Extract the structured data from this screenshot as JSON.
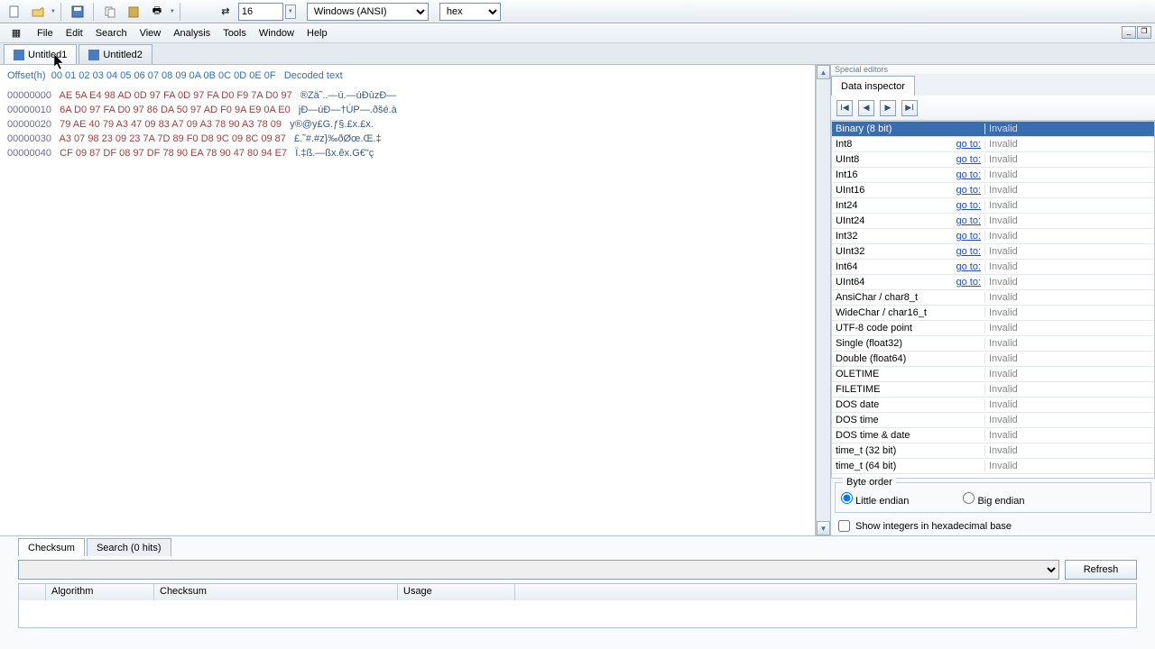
{
  "toolbar": {
    "lines": "16",
    "encoding": "Windows (ANSI)",
    "mode": "hex"
  },
  "menu": [
    "File",
    "Edit",
    "Search",
    "View",
    "Analysis",
    "Tools",
    "Window",
    "Help"
  ],
  "tabs": [
    "Untitled1",
    "Untitled2"
  ],
  "hex": {
    "header_offset": "Offset(h)",
    "header_cols": "00 01 02 03 04 05 06 07 08 09 0A 0B 0C 0D 0E 0F",
    "header_txt": "Decoded text",
    "rows": [
      {
        "o": "00000000",
        "b": "AE 5A E4 98 AD 0D 97 FA 0D 97 FA D0 F9 7A D0 97",
        "t": "®Zä˜..—ú.—úÐùzÐ—"
      },
      {
        "o": "00000010",
        "b": "6A D0 97 FA D0 97 86 DA 50 97 AD F0 9A E9 0A E0",
        "t": "jÐ—úÐ—†ÚP—.ðšé.à"
      },
      {
        "o": "00000020",
        "b": "79 AE 40 79 A3 47 09 83 A7 09 A3 78 90 A3 78 09",
        "t": "y®@y£G.ƒ§.£x.£x."
      },
      {
        "o": "00000030",
        "b": "A3 07 98 23 09 23 7A 7D 89 F0 D8 9C 09 8C 09 87",
        "t": "£.˜#.#z}‰ðØœ.Œ.‡"
      },
      {
        "o": "00000040",
        "b": "CF 09 87 DF 08 97 DF 78 90 EA 78 90 47 80 94 E7",
        "t": "Ï.‡ß.—ßx.êx.G€\"ç"
      }
    ]
  },
  "inspector": {
    "special_label": "Special editors",
    "tab": "Data inspector",
    "types": [
      {
        "n": "Binary (8 bit)",
        "g": false,
        "v": "Invalid",
        "sel": true
      },
      {
        "n": "Int8",
        "g": true,
        "v": "Invalid"
      },
      {
        "n": "UInt8",
        "g": true,
        "v": "Invalid"
      },
      {
        "n": "Int16",
        "g": true,
        "v": "Invalid"
      },
      {
        "n": "UInt16",
        "g": true,
        "v": "Invalid"
      },
      {
        "n": "Int24",
        "g": true,
        "v": "Invalid"
      },
      {
        "n": "UInt24",
        "g": true,
        "v": "Invalid"
      },
      {
        "n": "Int32",
        "g": true,
        "v": "Invalid"
      },
      {
        "n": "UInt32",
        "g": true,
        "v": "Invalid"
      },
      {
        "n": "Int64",
        "g": true,
        "v": "Invalid"
      },
      {
        "n": "UInt64",
        "g": true,
        "v": "Invalid"
      },
      {
        "n": "AnsiChar / char8_t",
        "g": false,
        "v": "Invalid"
      },
      {
        "n": "WideChar / char16_t",
        "g": false,
        "v": "Invalid"
      },
      {
        "n": "UTF-8 code point",
        "g": false,
        "v": "Invalid"
      },
      {
        "n": "Single (float32)",
        "g": false,
        "v": "Invalid"
      },
      {
        "n": "Double (float64)",
        "g": false,
        "v": "Invalid"
      },
      {
        "n": "OLETIME",
        "g": false,
        "v": "Invalid"
      },
      {
        "n": "FILETIME",
        "g": false,
        "v": "Invalid"
      },
      {
        "n": "DOS date",
        "g": false,
        "v": "Invalid"
      },
      {
        "n": "DOS time",
        "g": false,
        "v": "Invalid"
      },
      {
        "n": "DOS time & date",
        "g": false,
        "v": "Invalid"
      },
      {
        "n": "time_t (32 bit)",
        "g": false,
        "v": "Invalid"
      },
      {
        "n": "time_t (64 bit)",
        "g": false,
        "v": "Invalid"
      }
    ],
    "goto_label": "go to:",
    "byteorder_label": "Byte order",
    "little": "Little endian",
    "big": "Big endian",
    "showhex": "Show integers in hexadecimal base"
  },
  "bottom": {
    "tabs": [
      "Checksum",
      "Search (0 hits)"
    ],
    "refresh": "Refresh",
    "cols": [
      "",
      "Algorithm",
      "Checksum",
      "Usage"
    ]
  }
}
